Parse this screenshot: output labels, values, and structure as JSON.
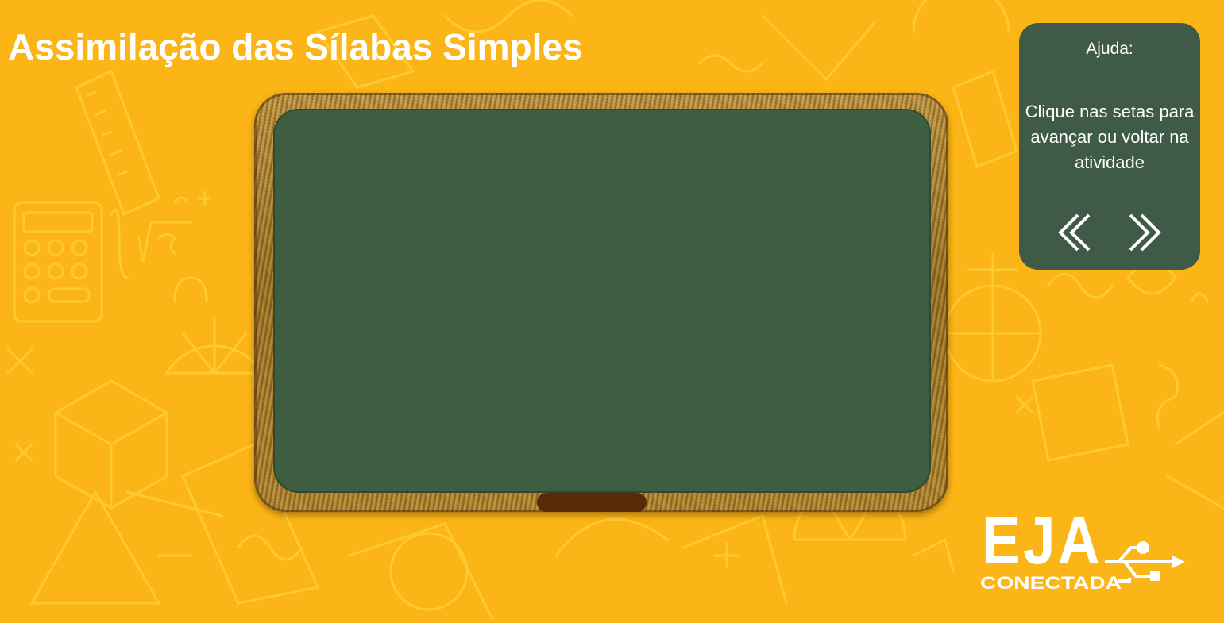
{
  "page": {
    "title": "Assimilação das Sílabas Simples"
  },
  "help": {
    "title": "Ajuda:",
    "text": "Clique nas setas para avançar ou voltar na atividade",
    "prev_icon": "double-chevron-left-icon",
    "next_icon": "double-chevron-right-icon"
  },
  "logo": {
    "main": "EJA",
    "sub": "CONECTADA"
  },
  "colors": {
    "background": "#fbb516",
    "board": "#3d5e40",
    "help_panel": "#3f5b47",
    "chalk_tray": "#5a2a08",
    "text": "#ffffff"
  }
}
